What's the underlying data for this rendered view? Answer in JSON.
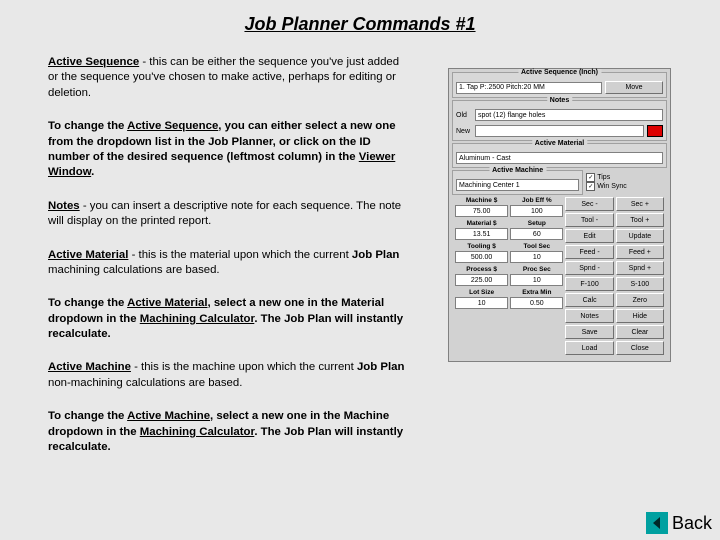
{
  "title": "Job Planner Commands #1",
  "paragraphs": {
    "p1a": "Active Sequence",
    "p1b": " - this can be either the sequence you've just added or the sequence you've chosen to make active, perhaps for editing or deletion.",
    "p2a": "To change the ",
    "p2b": "Active Sequence",
    "p2c": ", you can either select a new one from the dropdown list in the ",
    "p2d": "Job Planner",
    "p2e": ", or click on the ",
    "p2f": "ID",
    "p2g": " number of the desired sequence (leftmost column) in the ",
    "p2h": "Viewer Window",
    "p2i": ".",
    "p3a": "Notes",
    "p3b": " - you can insert a descriptive note for each sequence.  The note will display on the printed report.",
    "p4a": "Active Material",
    "p4b": " - this is the material upon which the current ",
    "p4c": "Job Plan",
    "p4d": " machining calculations are based.",
    "p5a": "To change the ",
    "p5b": "Active Material",
    "p5c": ", select a new one in the ",
    "p5d": "Material",
    "p5e": " dropdown in the ",
    "p5f": "Machining Calculator",
    "p5g": ".  The ",
    "p5h": "Job Plan",
    "p5i": " will instantly recalculate.",
    "p6a": "Active Machine",
    "p6b": " - this is the machine upon which the current ",
    "p6c": "Job Plan",
    "p6d": " non-machining calculations are based.",
    "p7a": "To change the ",
    "p7b": "Active Machine",
    "p7c": ", select a new one in the ",
    "p7d": "Machine",
    "p7e": " dropdown in the ",
    "p7f": "Machining Calculator",
    "p7g": ". The ",
    "p7h": "Job Plan",
    "p7i": " will instantly recalculate."
  },
  "panel": {
    "activeSeqLabel": "Active Sequence (Inch)",
    "activeSeqValue": "1. Tap   P:.2500   Pitch:20 MM",
    "moveBtn": "Move",
    "notesLabel": "Notes",
    "oldLbl": "Old",
    "newLbl": "New",
    "notesValue": "spot (12) flange holes",
    "activeMatLabel": "Active Material",
    "activeMatValue": "Aluminum - Cast",
    "activeMachLabel": "Active Machine",
    "activeMachValue": "Machining Center 1",
    "tipsChk": "Tips",
    "winSyncChk": "Win Sync",
    "machS": "Machine $",
    "machSVal": "75.00",
    "jobEff": "Job Eff %",
    "jobEffVal": "100",
    "matS": "Material $",
    "matSVal": "13.51",
    "setup": "Setup",
    "setupVal": "60",
    "toolS": "Tooling $",
    "toolSVal": "500.00",
    "toolSec": "Tool Sec",
    "toolSecVal": "10",
    "procS": "Process $",
    "procSVal": "225.00",
    "procSec": "Proc Sec",
    "procSecVal": "10",
    "lotSize": "Lot Size",
    "lotSizeVal": "10",
    "extraMin": "Extra Min",
    "extraMinVal": "0.50",
    "btns": {
      "secM": "Sec -",
      "secP": "Sec +",
      "toolM": "Tool -",
      "toolP": "Tool +",
      "edit": "Edit",
      "update": "Update",
      "feedM": "Feed -",
      "feedP": "Feed +",
      "spndM": "Spnd -",
      "spndP": "Spnd +",
      "f100": "F-100",
      "s100": "S-100",
      "calc": "Calc",
      "zero": "Zero",
      "notes": "Notes",
      "hide": "Hide",
      "save": "Save",
      "clear": "Clear",
      "load": "Load",
      "close": "Close"
    }
  },
  "back": "Back"
}
